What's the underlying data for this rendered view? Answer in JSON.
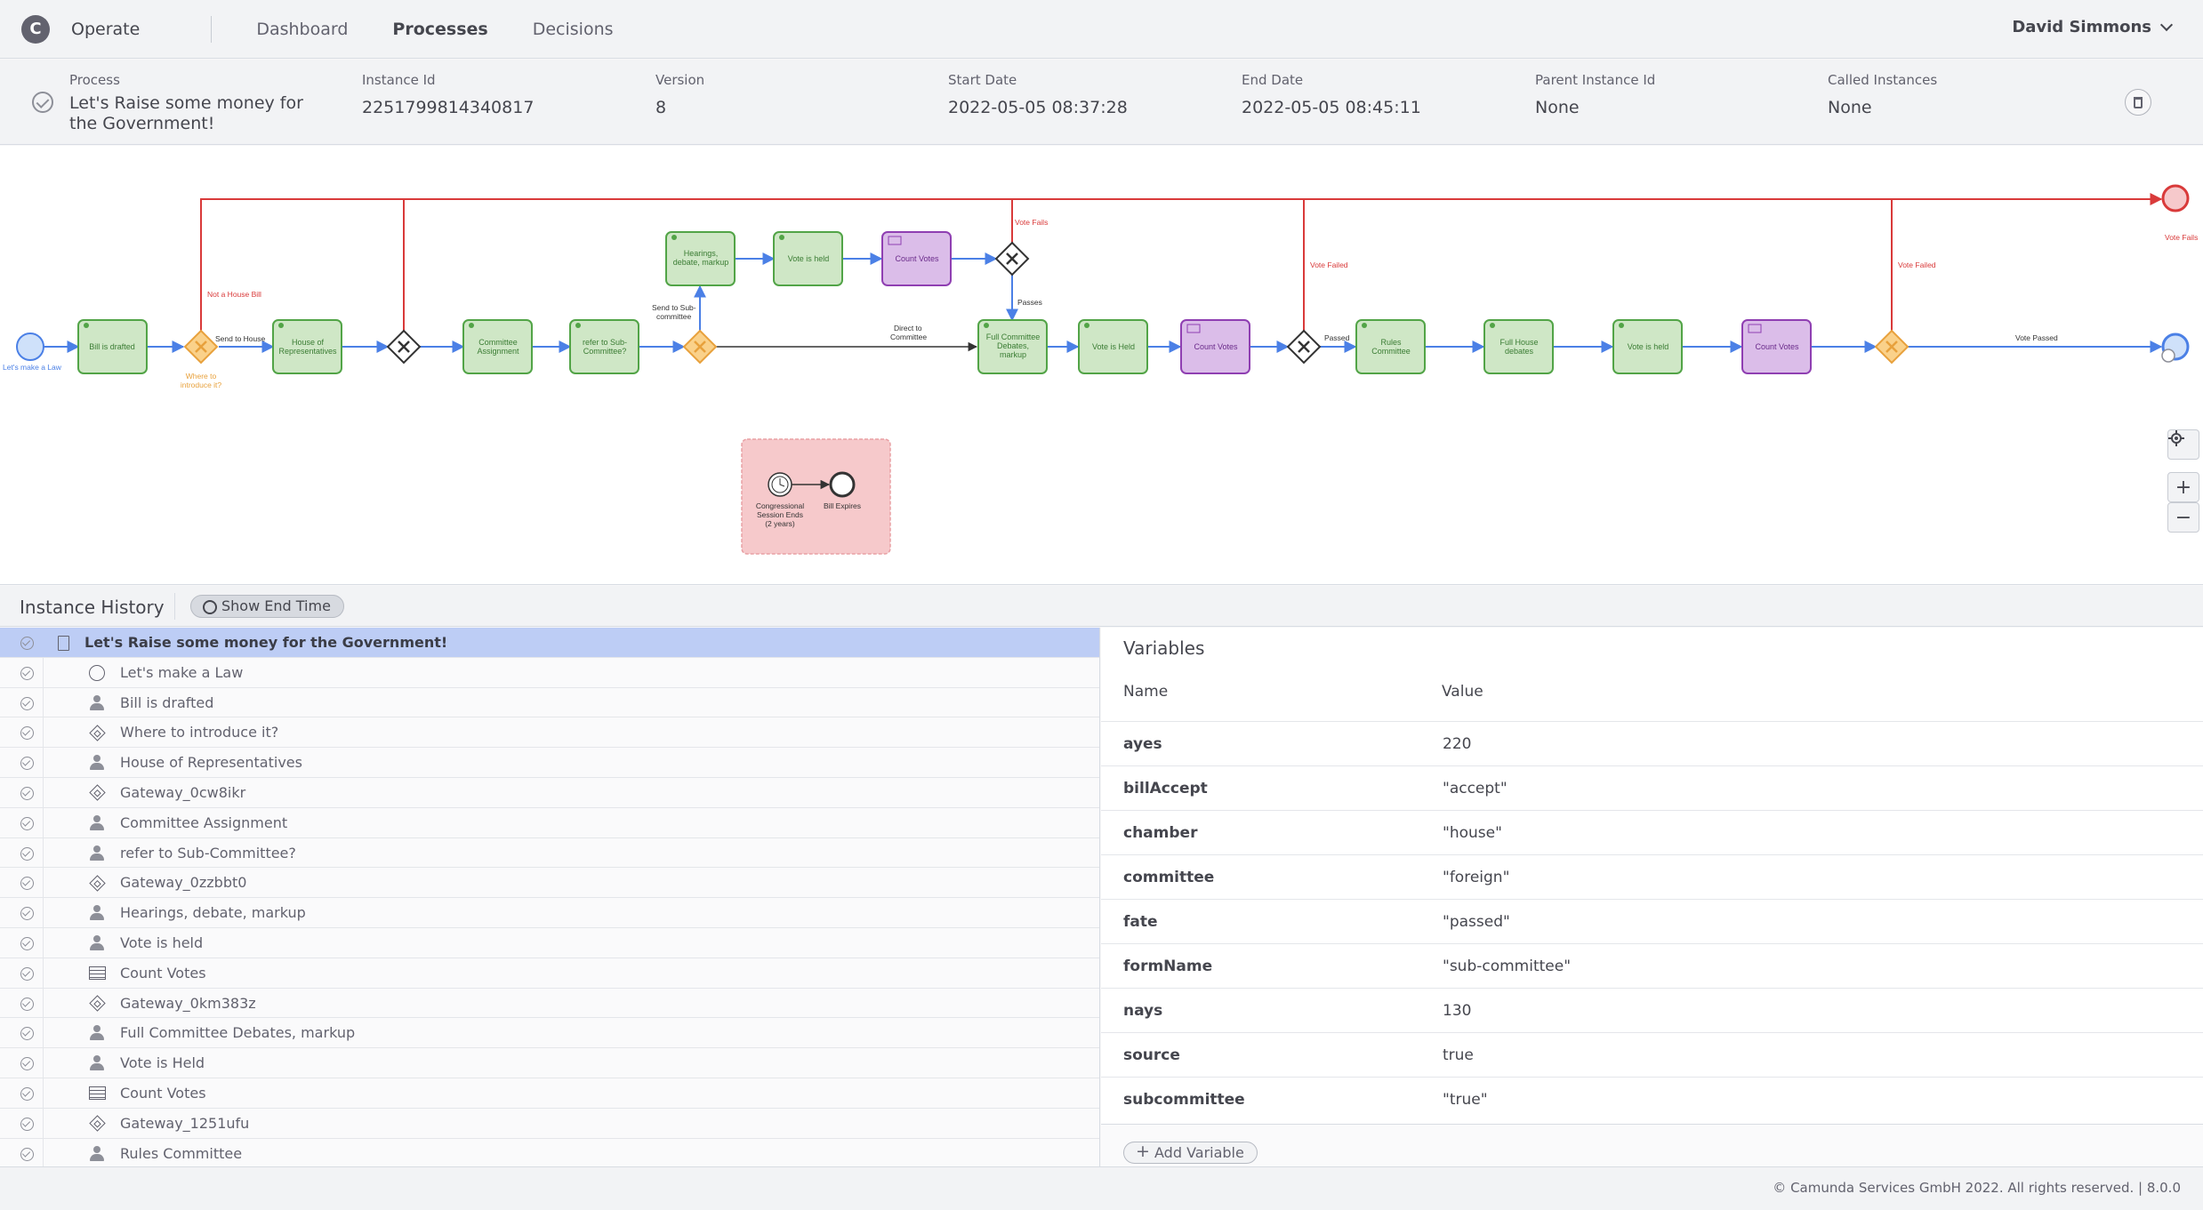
{
  "nav": {
    "logo": "C",
    "brand": "Operate",
    "links": [
      "Dashboard",
      "Processes",
      "Decisions"
    ],
    "user": "David Simmons"
  },
  "instance": {
    "columns": [
      {
        "label": "Process",
        "value": "Let's Raise some money for the Government!"
      },
      {
        "label": "Instance Id",
        "value": "2251799814340817"
      },
      {
        "label": "Version",
        "value": "8"
      },
      {
        "label": "Start Date",
        "value": "2022-05-05 08:37:28"
      },
      {
        "label": "End Date",
        "value": "2022-05-05 08:45:11"
      },
      {
        "label": "Parent Instance Id",
        "value": "None"
      },
      {
        "label": "Called Instances",
        "value": "None"
      }
    ]
  },
  "diagram": {
    "nodes": {
      "start": "Let's make a Law",
      "bill_drafted": [
        "Bill is drafted"
      ],
      "where_intro": [
        "Where to",
        "introduce it?"
      ],
      "house_reps": [
        "House of",
        "Representatives"
      ],
      "committee_assign": [
        "Committee",
        "Assignment"
      ],
      "refer_sub": [
        "refer to Sub-",
        "Committee?"
      ],
      "hearings": [
        "Hearings,",
        "debate, markup"
      ],
      "vote_held_1": [
        "Vote is held"
      ],
      "count_votes_1": [
        "Count Votes"
      ],
      "full_committee": [
        "Full Committee",
        "Debates,",
        "markup"
      ],
      "vote_held_2": [
        "Vote is Held"
      ],
      "count_votes_2": [
        "Count Votes"
      ],
      "rules_committee": [
        "Rules",
        "Committee"
      ],
      "full_house": [
        "Full House",
        "debates"
      ],
      "vote_held_3": [
        "Vote is held"
      ],
      "count_votes_3": [
        "Count Votes"
      ],
      "timer": [
        "Congressional",
        "Session Ends",
        "(2 years)"
      ],
      "bill_expires": [
        "Bill Expires"
      ]
    },
    "flow_labels": {
      "not_house": "Not a House Bill",
      "send_house": "Send to House",
      "send_sub": [
        "Send to Sub-",
        "committee"
      ],
      "direct_committee": [
        "Direct to",
        "Committee"
      ],
      "vote_fails_1": "Vote Fails",
      "passes": "Passes",
      "vote_failed_2": "Vote Failed",
      "passed": "Passed",
      "vote_failed_3": "Vote Failed",
      "vote_passed": "Vote Passed",
      "vote_fails_end": "Vote Fails"
    },
    "colors": {
      "completed_fill": "#cfe7c6",
      "completed_stroke": "#52a447",
      "decision_fill": "#dbbde9",
      "decision_stroke": "#8f3fb2",
      "gateway_fill": "#fad18a",
      "gateway_stroke": "#e8a13c",
      "flow_blue": "#4b80e6",
      "flow_red": "#d93a3a",
      "timer_fill": "#f6c9cb"
    },
    "zoom": [
      "+",
      "−"
    ]
  },
  "history": {
    "title": "Instance History",
    "show_end_time": "Show End Time",
    "rows": [
      {
        "label": "Let's Raise some money for the Government!",
        "icon": "document-icon",
        "selected": true
      },
      {
        "label": "Let's make a Law",
        "icon": "start-event-icon"
      },
      {
        "label": "Bill is drafted",
        "icon": "user-task-icon"
      },
      {
        "label": "Where to introduce it?",
        "icon": "gateway-icon"
      },
      {
        "label": "House of Representatives",
        "icon": "user-task-icon"
      },
      {
        "label": "Gateway_0cw8ikr",
        "icon": "gateway-icon"
      },
      {
        "label": "Committee Assignment",
        "icon": "user-task-icon"
      },
      {
        "label": "refer to Sub-Committee?",
        "icon": "user-task-icon"
      },
      {
        "label": "Gateway_0zzbbt0",
        "icon": "gateway-icon"
      },
      {
        "label": "Hearings, debate, markup",
        "icon": "user-task-icon"
      },
      {
        "label": "Vote is held",
        "icon": "user-task-icon"
      },
      {
        "label": "Count Votes",
        "icon": "decision-table-icon"
      },
      {
        "label": "Gateway_0km383z",
        "icon": "gateway-icon"
      },
      {
        "label": "Full Committee Debates, markup",
        "icon": "user-task-icon"
      },
      {
        "label": "Vote is Held",
        "icon": "user-task-icon"
      },
      {
        "label": "Count Votes",
        "icon": "decision-table-icon"
      },
      {
        "label": "Gateway_1251ufu",
        "icon": "gateway-icon"
      },
      {
        "label": "Rules Committee",
        "icon": "user-task-icon"
      }
    ]
  },
  "variables": {
    "title": "Variables",
    "col_name": "Name",
    "col_value": "Value",
    "rows": [
      {
        "name": "ayes",
        "value": "220"
      },
      {
        "name": "billAccept",
        "value": "\"accept\""
      },
      {
        "name": "chamber",
        "value": "\"house\""
      },
      {
        "name": "committee",
        "value": "\"foreign\""
      },
      {
        "name": "fate",
        "value": "\"passed\""
      },
      {
        "name": "formName",
        "value": "\"sub-committee\""
      },
      {
        "name": "nays",
        "value": "130"
      },
      {
        "name": "source",
        "value": "true"
      },
      {
        "name": "subcommittee",
        "value": "\"true\""
      }
    ],
    "add_label": "Add Variable"
  },
  "footer": "© Camunda Services GmbH 2022. All rights reserved. | 8.0.0"
}
